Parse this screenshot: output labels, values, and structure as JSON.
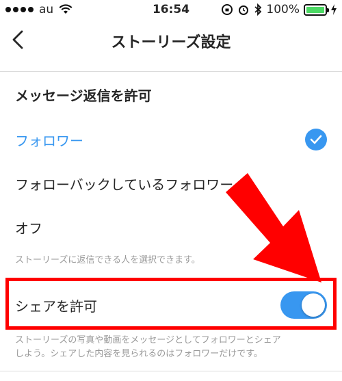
{
  "status_bar": {
    "carrier": "au",
    "time": "16:54",
    "battery": "100%"
  },
  "nav": {
    "title": "ストーリーズ設定"
  },
  "message_reply": {
    "title": "メッセージ返信を許可",
    "options": [
      {
        "label": "フォロワー",
        "selected": true
      },
      {
        "label": "フォローバックしているフォロワー",
        "selected": false
      },
      {
        "label": "オフ",
        "selected": false
      }
    ],
    "hint": "ストーリーズに返信できる人を選択できます。"
  },
  "share": {
    "label": "シェアを許可",
    "enabled": true,
    "hint_line1": "ストーリーズの写真や動画をメッセージとしてフォロワーとシェア",
    "hint_line2": "しよう。シェアした内容を見られるのはフォロワーだけです。"
  },
  "colors": {
    "accent": "#3897f0",
    "annotation": "#ff0000",
    "battery": "#4cd964"
  }
}
